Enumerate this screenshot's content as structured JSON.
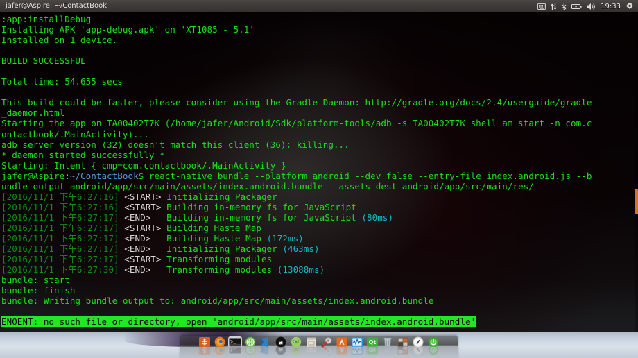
{
  "window": {
    "title": "jafer@Aspire: ~/ContactBook"
  },
  "tray": {
    "clock": "19:33",
    "icons": [
      {
        "name": "keyboard-icon"
      },
      {
        "name": "network-updown-icon"
      },
      {
        "name": "bluetooth-icon"
      },
      {
        "name": "battery-icon"
      },
      {
        "name": "volume-icon"
      },
      {
        "name": "settings-gear-icon"
      }
    ]
  },
  "terminal": {
    "lines": [
      {
        "segs": [
          {
            "t": ":app:installDebug",
            "c": "g"
          }
        ]
      },
      {
        "segs": [
          {
            "t": "Installing APK 'app-debug.apk' on 'XT1085 - 5.1'",
            "c": "g"
          }
        ]
      },
      {
        "segs": [
          {
            "t": "Installed on 1 device.",
            "c": "g"
          }
        ]
      },
      {
        "segs": [
          {
            "t": "",
            "c": "g"
          }
        ]
      },
      {
        "segs": [
          {
            "t": "BUILD SUCCESSFUL",
            "c": "g"
          }
        ]
      },
      {
        "segs": [
          {
            "t": "",
            "c": "g"
          }
        ]
      },
      {
        "segs": [
          {
            "t": "Total time: 54.655 secs",
            "c": "g"
          }
        ]
      },
      {
        "segs": [
          {
            "t": "",
            "c": "g"
          }
        ]
      },
      {
        "segs": [
          {
            "t": "This build could be faster, please consider using the Gradle Daemon: http://gradle.org/docs/2.4/userguide/gradle",
            "c": "g"
          }
        ]
      },
      {
        "segs": [
          {
            "t": "_daemon.html",
            "c": "g"
          }
        ]
      },
      {
        "segs": [
          {
            "t": "Starting the app on TA00402T7K (/home/jafer/Android/Sdk/platform-tools/adb -s TA00402T7K shell am start -n com.c",
            "c": "g"
          }
        ]
      },
      {
        "segs": [
          {
            "t": "ontactbook/.MainActivity)...",
            "c": "g"
          }
        ]
      },
      {
        "segs": [
          {
            "t": "adb server version (32) doesn't match this client (36); killing...",
            "c": "g"
          }
        ]
      },
      {
        "segs": [
          {
            "t": "* daemon started successfully *",
            "c": "g"
          }
        ]
      },
      {
        "segs": [
          {
            "t": "Starting: Intent { cmp=com.contactbook/.MainActivity }",
            "c": "g"
          }
        ]
      },
      {
        "segs": [
          {
            "t": "jafer@Aspire",
            "c": "g"
          },
          {
            "t": ":",
            "c": "wht"
          },
          {
            "t": "~/ContactBook",
            "c": "blu"
          },
          {
            "t": "$ react-native bundle --platform android --dev false --entry-file index.android.js --b",
            "c": "g"
          }
        ]
      },
      {
        "segs": [
          {
            "t": "undle-output android/app/src/main/assets/index.android.bundle --assets-dest android/app/src/main/res/",
            "c": "g"
          }
        ]
      },
      {
        "segs": [
          {
            "t": "[2016/11/1 ",
            "c": "gd"
          },
          {
            "t": "下午6:27:16] ",
            "c": "gd"
          },
          {
            "t": "<START> ",
            "c": "wht"
          },
          {
            "t": "Initializing Packager",
            "c": "g"
          }
        ]
      },
      {
        "segs": [
          {
            "t": "[2016/11/1 下午6:27:16] ",
            "c": "gd"
          },
          {
            "t": "<START> ",
            "c": "wht"
          },
          {
            "t": "Building in-memory fs for JavaScript",
            "c": "g"
          }
        ]
      },
      {
        "segs": [
          {
            "t": "[2016/11/1 下午6:27:17] ",
            "c": "gd"
          },
          {
            "t": "<END>   ",
            "c": "wht"
          },
          {
            "t": "Building in-memory fs for JavaScript ",
            "c": "g"
          },
          {
            "t": "(80ms)",
            "c": "cy"
          }
        ]
      },
      {
        "segs": [
          {
            "t": "[2016/11/1 下午6:27:17] ",
            "c": "gd"
          },
          {
            "t": "<START> ",
            "c": "wht"
          },
          {
            "t": "Building Haste Map",
            "c": "g"
          }
        ]
      },
      {
        "segs": [
          {
            "t": "[2016/11/1 下午6:27:17] ",
            "c": "gd"
          },
          {
            "t": "<END>   ",
            "c": "wht"
          },
          {
            "t": "Building Haste Map ",
            "c": "g"
          },
          {
            "t": "(172ms)",
            "c": "cy"
          }
        ]
      },
      {
        "segs": [
          {
            "t": "[2016/11/1 下午6:27:17] ",
            "c": "gd"
          },
          {
            "t": "<END>   ",
            "c": "wht"
          },
          {
            "t": "Initializing Packager ",
            "c": "g"
          },
          {
            "t": "(463ms)",
            "c": "cy"
          }
        ]
      },
      {
        "segs": [
          {
            "t": "[2016/11/1 下午6:27:17] ",
            "c": "gd"
          },
          {
            "t": "<START> ",
            "c": "wht"
          },
          {
            "t": "Transforming modules",
            "c": "g"
          }
        ]
      },
      {
        "segs": [
          {
            "t": "[2016/11/1 下午6:27:30] ",
            "c": "gd"
          },
          {
            "t": "<END>   ",
            "c": "wht"
          },
          {
            "t": "Transforming modules ",
            "c": "g"
          },
          {
            "t": "(13088ms)",
            "c": "cy"
          }
        ]
      },
      {
        "segs": [
          {
            "t": "bundle: start",
            "c": "g"
          }
        ]
      },
      {
        "segs": [
          {
            "t": "bundle: finish",
            "c": "g"
          }
        ]
      },
      {
        "segs": [
          {
            "t": "bundle: Writing bundle output to: android/app/src/main/assets/index.android.bundle",
            "c": "g"
          }
        ]
      },
      {
        "segs": [
          {
            "t": "",
            "c": "g"
          }
        ]
      },
      {
        "segs": [
          {
            "t": "ENOENT: no such file or directory, open 'android/app/src/main/assets/index.android.bundle'",
            "c": "sel"
          }
        ]
      }
    ]
  },
  "scrollbar": {
    "thumb_color": "#d4742a"
  },
  "dock": {
    "items": [
      {
        "name": "dock-item-cairo-dock",
        "label": "",
        "icon": "anchor-icon",
        "color": "#d2622a"
      },
      {
        "name": "dock-item-firefox",
        "label": "",
        "icon": "firefox-icon",
        "color": "#e8761e"
      },
      {
        "name": "dock-item-terminal",
        "label": "",
        "icon": "terminal-icon",
        "color": "#2b2b2b"
      },
      {
        "name": "dock-item-android-emulator",
        "label": "",
        "icon": "green-globe-icon",
        "color": "#6cb44a"
      },
      {
        "name": "dock-item-vscode",
        "label": "",
        "icon": "vscode-icon",
        "color": "#2f7fc1"
      },
      {
        "name": "dock-item-atom",
        "label": "a",
        "icon": "atom-a-icon",
        "color": "#111111"
      },
      {
        "name": "dock-item-android-studio",
        "label": "",
        "icon": "android-studio-icon",
        "color": "#8bc34a"
      },
      {
        "name": "dock-item-files",
        "label": "",
        "icon": "file-manager-icon",
        "color": "#d8d4cc"
      },
      {
        "name": "dock-item-tools",
        "label": "",
        "icon": "tools-icon",
        "color": "#d6d2cc"
      },
      {
        "name": "dock-item-atom-orange",
        "label": "",
        "icon": "atom-orange-icon",
        "color": "#e8681e"
      },
      {
        "name": "dock-item-system-monitor",
        "label": "",
        "icon": "system-monitor-icon",
        "color": "#1e8fe0"
      },
      {
        "name": "dock-item-qt-creator",
        "label": "Qt",
        "icon": "qt-icon",
        "color": "#3fae3f"
      },
      {
        "name": "dock-item-trash",
        "label": "",
        "icon": "trash-icon",
        "color": "#b8c2ca"
      },
      {
        "name": "dock-item-workspaces",
        "label": "",
        "icon": "grid-icon",
        "color": "#7a6e66"
      },
      {
        "name": "dock-item-compass",
        "label": "",
        "icon": "compass-icon",
        "color": "#e4e4e4"
      },
      {
        "name": "dock-item-power",
        "label": "",
        "icon": "power-icon",
        "color": "#3aa82e"
      }
    ]
  }
}
